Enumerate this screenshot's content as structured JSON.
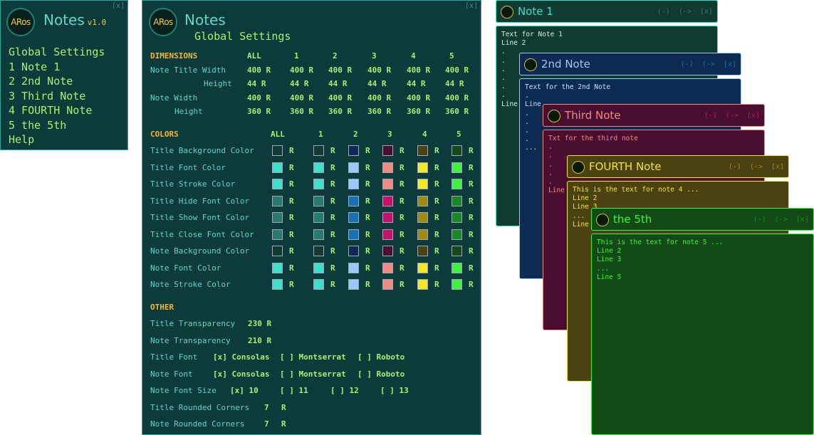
{
  "app": {
    "logo": "ARos",
    "name": "Notes",
    "version": "v1.0",
    "close": "[x]"
  },
  "menu": [
    "Global Settings",
    "1 Note 1",
    "2 2nd Note",
    "3 Third Note",
    "4 FOURTH Note",
    "5 the 5th",
    "Help"
  ],
  "settings": {
    "title": "Notes",
    "subtitle": "Global Settings",
    "close": "[x]",
    "dimensions": {
      "heading": "DIMENSIONS",
      "columns": [
        "ALL",
        "1",
        "2",
        "3",
        "4",
        "5"
      ],
      "rows": [
        {
          "label": "Note Title Width",
          "values": [
            "400 R",
            "400 R",
            "400 R",
            "400 R",
            "400 R",
            "400 R"
          ]
        },
        {
          "label": "Height",
          "values": [
            "44 R",
            "44 R",
            "44 R",
            "44 R",
            "44 R",
            "44 R"
          ]
        },
        {
          "label": "Note Width",
          "values": [
            "400 R",
            "400 R",
            "400 R",
            "400 R",
            "400 R",
            "400 R"
          ]
        },
        {
          "label": "Height",
          "values": [
            "360 R",
            "360 R",
            "360 R",
            "360 R",
            "360 R",
            "360 R"
          ]
        }
      ]
    },
    "colors": {
      "heading": "COLORS",
      "columns": [
        "ALL",
        "1",
        "2",
        "3",
        "4",
        "5"
      ],
      "r_label": "R",
      "rows": [
        {
          "label": "Title Background Color",
          "swatches": [
            "#0f3b33",
            "#0f3b33",
            "#0c2a52",
            "#4a0e30",
            "#4a4210",
            "#134b18"
          ]
        },
        {
          "label": "Title Font Color",
          "swatches": [
            "#3ee0c8",
            "#3ee0c8",
            "#9ec8f5",
            "#f08a84",
            "#f5e626",
            "#3cf53a"
          ]
        },
        {
          "label": "Title Stroke Color",
          "swatches": [
            "#3ee0c8",
            "#3ee0c8",
            "#9ec8f5",
            "#f08a84",
            "#f5e626",
            "#3cf53a"
          ]
        },
        {
          "label": "Title Hide Font Color",
          "swatches": [
            "#2a7a6e",
            "#2a7a6e",
            "#1a70b0",
            "#c0156a",
            "#a08a10",
            "#188a22"
          ]
        },
        {
          "label": "Title Show Font Color",
          "swatches": [
            "#2a7a6e",
            "#2a7a6e",
            "#1a70b0",
            "#c0156a",
            "#a08a10",
            "#188a22"
          ]
        },
        {
          "label": "Title Close Font Color",
          "swatches": [
            "#2a7a6e",
            "#2a7a6e",
            "#1a70b0",
            "#c0156a",
            "#a08a10",
            "#188a22"
          ]
        },
        {
          "label": "Note Background Color",
          "swatches": [
            "#0f3b33",
            "#0f3b33",
            "#0c2a52",
            "#4a0e30",
            "#4a4210",
            "#134b18"
          ]
        },
        {
          "label": "Note Font Color",
          "swatches": [
            "#3ee0c8",
            "#3ee0c8",
            "#9ec8f5",
            "#f08a84",
            "#f5e626",
            "#3cf53a"
          ]
        },
        {
          "label": "Note Stroke Color",
          "swatches": [
            "#3ee0c8",
            "#3ee0c8",
            "#9ec8f5",
            "#f08a84",
            "#f5e626",
            "#3cf53a"
          ]
        }
      ]
    },
    "other": {
      "heading": "OTHER",
      "title_transparency": {
        "label": "Title Transparency",
        "value": "230 R"
      },
      "note_transparency": {
        "label": "Note Transparency",
        "value": "210 R"
      },
      "title_font": {
        "label": "Title Font",
        "options": [
          "[x] Consolas",
          "[ ] Montserrat",
          "[ ] Roboto"
        ]
      },
      "note_font": {
        "label": "Note Font",
        "options": [
          "[x] Consolas",
          "[ ] Montserrat",
          "[ ] Roboto"
        ]
      },
      "note_font_size": {
        "label": "Note Font Size",
        "options": [
          "[x] 10",
          "[ ] 11",
          "[ ] 12",
          "[ ] 13"
        ]
      },
      "title_rounded": {
        "label": "Title Rounded Corners",
        "value": "7",
        "r": "R"
      },
      "note_rounded": {
        "label": "Note Rounded Corners",
        "value": "7",
        "r": "R"
      }
    }
  },
  "notes": [
    {
      "name": "Note 1",
      "controls": "(-)  (->  [x]",
      "text": "Text for Note 1\nLine 2\n.\n.\n.\n.\n.\n.\nLine",
      "title_bg": "#0f3b33",
      "font": "#3ee0c8",
      "stroke": "#3ee0c8",
      "ctl": "#2a7a6e",
      "body_bg": "#0f3b33",
      "text_color": "#c8f0ea"
    },
    {
      "name": "2nd Note",
      "controls": "(-)  (->  [x]",
      "text": "Text for the 2nd Note\n.\nLine\n.\n.\n.\n.\n...",
      "title_bg": "#0c2a52",
      "font": "#9ec8f5",
      "stroke": "#9ec8f5",
      "ctl": "#1a70b0",
      "body_bg": "#0c2a52",
      "text_color": "#c8e0f8"
    },
    {
      "name": "Third Note",
      "controls": "(-)  (->  [x]",
      "text": "Txt for the third note\n.\n.\n.\n.\n.\nLine",
      "title_bg": "#4a0e30",
      "font": "#f08a84",
      "stroke": "#f08a84",
      "ctl": "#c0156a",
      "body_bg": "#4a0e30",
      "text_color": "#f08a84"
    },
    {
      "name": "FOURTH Note",
      "controls": "(-)  (->  [x]",
      "text": "This is the text for note 4 ...\nLine 2\nLine 3\n...\nLine",
      "title_bg": "#4a4210",
      "font": "#f5e626",
      "stroke": "#f5e626",
      "ctl": "#a08a10",
      "body_bg": "#4a4210",
      "text_color": "#f5e626"
    },
    {
      "name": "the 5th",
      "controls": "(-)  (->  [x]",
      "text": "This is the text for note 5 ...\nLine 2\nLine 3\n...\nLine 5",
      "title_bg": "#134b18",
      "font": "#3cf53a",
      "stroke": "#3cf53a",
      "ctl": "#188a22",
      "body_bg": "#134b18",
      "text_color": "#3cf53a"
    }
  ]
}
